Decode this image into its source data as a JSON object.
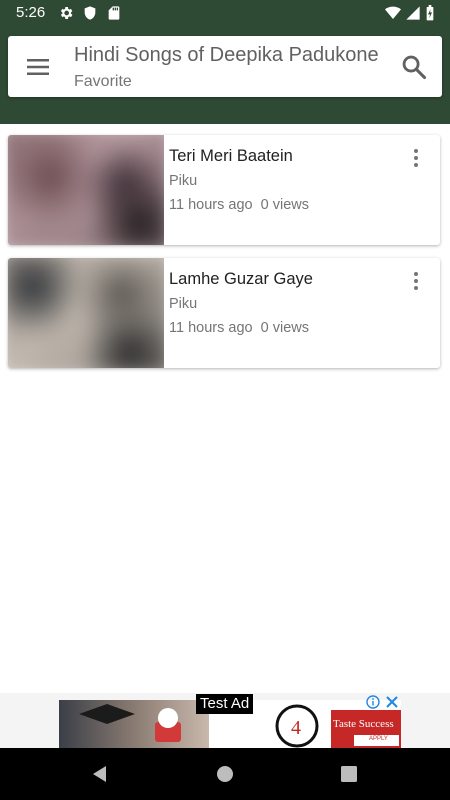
{
  "status_bar": {
    "time": "5:26",
    "icons": [
      "gear-icon",
      "shield-icon",
      "sd-card-icon",
      "wifi-icon",
      "signal-icon",
      "battery-icon"
    ]
  },
  "header": {
    "title": "Hindi Songs of Deepika Padukone",
    "subtitle": "Favorite",
    "menu_icon": "menu-icon",
    "search_icon": "search-icon",
    "background_color": "#2f4a34"
  },
  "videos": [
    {
      "title": "Teri Meri Baatein",
      "channel": "Piku",
      "time_ago": "11 hours ago",
      "views": "0 views"
    },
    {
      "title": "Lamhe Guzar Gaye",
      "channel": "Piku",
      "time_ago": "11 hours ago",
      "views": "0 views"
    }
  ],
  "ad": {
    "label": "Test Ad",
    "brand_text": "Taste Success",
    "cta": "APPLY",
    "info_icon": "info-icon",
    "close_icon": "close-icon"
  },
  "nav_bar": {
    "buttons": [
      "back-icon",
      "home-icon",
      "recents-icon"
    ]
  }
}
